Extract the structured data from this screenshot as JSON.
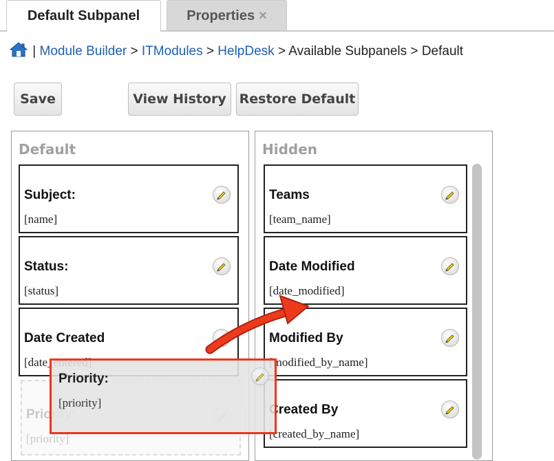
{
  "tabs": {
    "default_subpanel": "Default Subpanel",
    "properties": "Properties",
    "close": "×"
  },
  "breadcrumb": {
    "separator": "|",
    "module_builder": "Module Builder",
    "gt": ">",
    "itmodules": "ITModules",
    "helpdesk": "HelpDesk",
    "available_subpanels": "Available Subpanels",
    "default": "Default"
  },
  "buttons": {
    "save": "Save",
    "view_history": "View History",
    "restore_default": "Restore Default"
  },
  "default_panel": {
    "title": "Default",
    "fields": [
      {
        "label": "Subject:",
        "name": "[name]"
      },
      {
        "label": "Status:",
        "name": "[status]"
      },
      {
        "label": "Date Created",
        "name": "[date_entered]"
      }
    ]
  },
  "hidden_panel": {
    "title": "Hidden",
    "fields": [
      {
        "label": "Teams",
        "name": "[team_name]"
      },
      {
        "label": "Date Modified",
        "name": "[date_modified]"
      },
      {
        "label": "Modified By",
        "name": "[modified_by_name]"
      },
      {
        "label": "Created By",
        "name": "[created_by_name]"
      }
    ]
  },
  "dragged_field": {
    "label": "Priority:",
    "name": "[priority]"
  },
  "ghost_field": {
    "label": "Priority:",
    "name": "[priority]"
  },
  "colors": {
    "link": "#1e5fb4",
    "highlight": "#f0341a",
    "panel_title": "#a0a0a0"
  }
}
